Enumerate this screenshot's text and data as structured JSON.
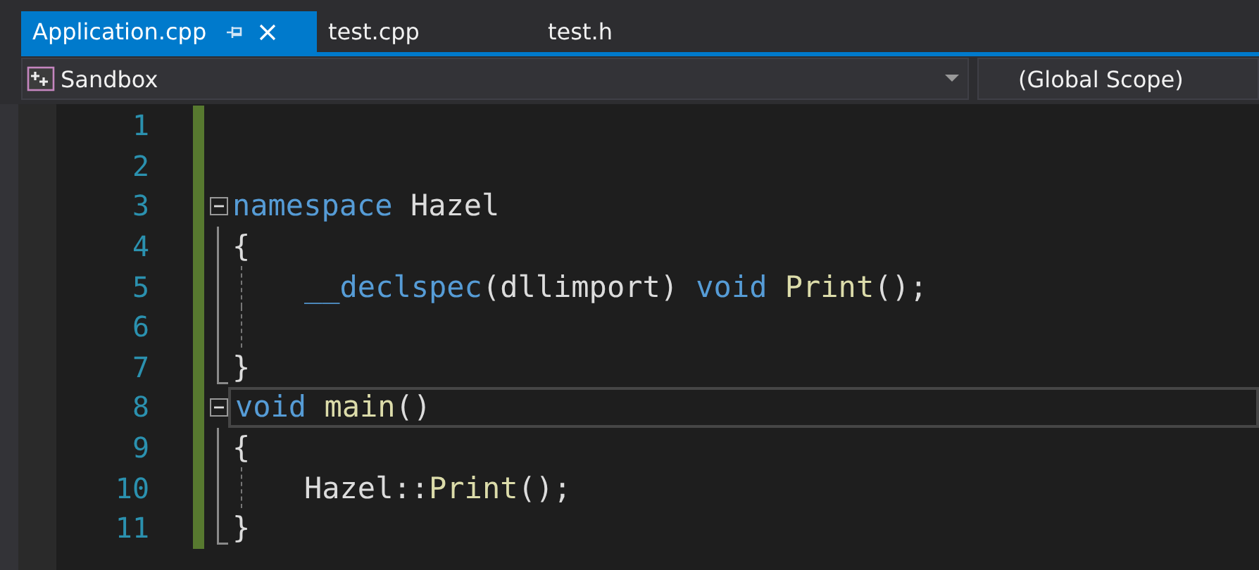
{
  "tabs": [
    {
      "label": "Application.cpp",
      "selected": true
    },
    {
      "label": "test.cpp",
      "selected": false
    },
    {
      "label": "test.h",
      "selected": false
    }
  ],
  "navigation": {
    "project": "Sandbox",
    "scope": "(Global Scope)"
  },
  "editor": {
    "lines": [
      {
        "number": "1",
        "changed": true
      },
      {
        "number": "2",
        "changed": true
      },
      {
        "number": "3",
        "changed": true,
        "expanded": true,
        "tokens": [
          {
            "kind": "keyword",
            "text": "namespace"
          },
          {
            "kind": "plain",
            "text": " Hazel"
          }
        ]
      },
      {
        "number": "4",
        "changed": true,
        "in_block": true,
        "tokens": [
          {
            "kind": "plain",
            "text": "{"
          }
        ]
      },
      {
        "number": "5",
        "changed": true,
        "in_block": true,
        "indent_guide": true,
        "indented": true,
        "tokens": [
          {
            "kind": "keyword",
            "text": "__declspec"
          },
          {
            "kind": "plain",
            "text": "(dllimport) "
          },
          {
            "kind": "keyword",
            "text": "void"
          },
          {
            "kind": "function",
            "text": " Print"
          },
          {
            "kind": "plain",
            "text": "();"
          }
        ]
      },
      {
        "number": "6",
        "changed": true,
        "in_block": true,
        "indent_guide": true
      },
      {
        "number": "7",
        "changed": true,
        "block_end": true,
        "tokens": [
          {
            "kind": "plain",
            "text": "}"
          }
        ]
      },
      {
        "number": "8",
        "changed": true,
        "expanded": true,
        "current": true,
        "tokens": [
          {
            "kind": "keyword",
            "text": "void"
          },
          {
            "kind": "function",
            "text": " main"
          },
          {
            "kind": "plain",
            "text": "()"
          }
        ]
      },
      {
        "number": "9",
        "changed": true,
        "in_block": true,
        "tokens": [
          {
            "kind": "plain",
            "text": "{"
          }
        ]
      },
      {
        "number": "10",
        "changed": true,
        "in_block": true,
        "indent_guide": true,
        "indented": true,
        "tokens": [
          {
            "kind": "plain",
            "text": "Hazel::"
          },
          {
            "kind": "function",
            "text": "Print"
          },
          {
            "kind": "plain",
            "text": "();"
          }
        ]
      },
      {
        "number": "11",
        "changed": true,
        "block_end": true,
        "tokens": [
          {
            "kind": "plain",
            "text": "}"
          }
        ]
      }
    ]
  }
}
